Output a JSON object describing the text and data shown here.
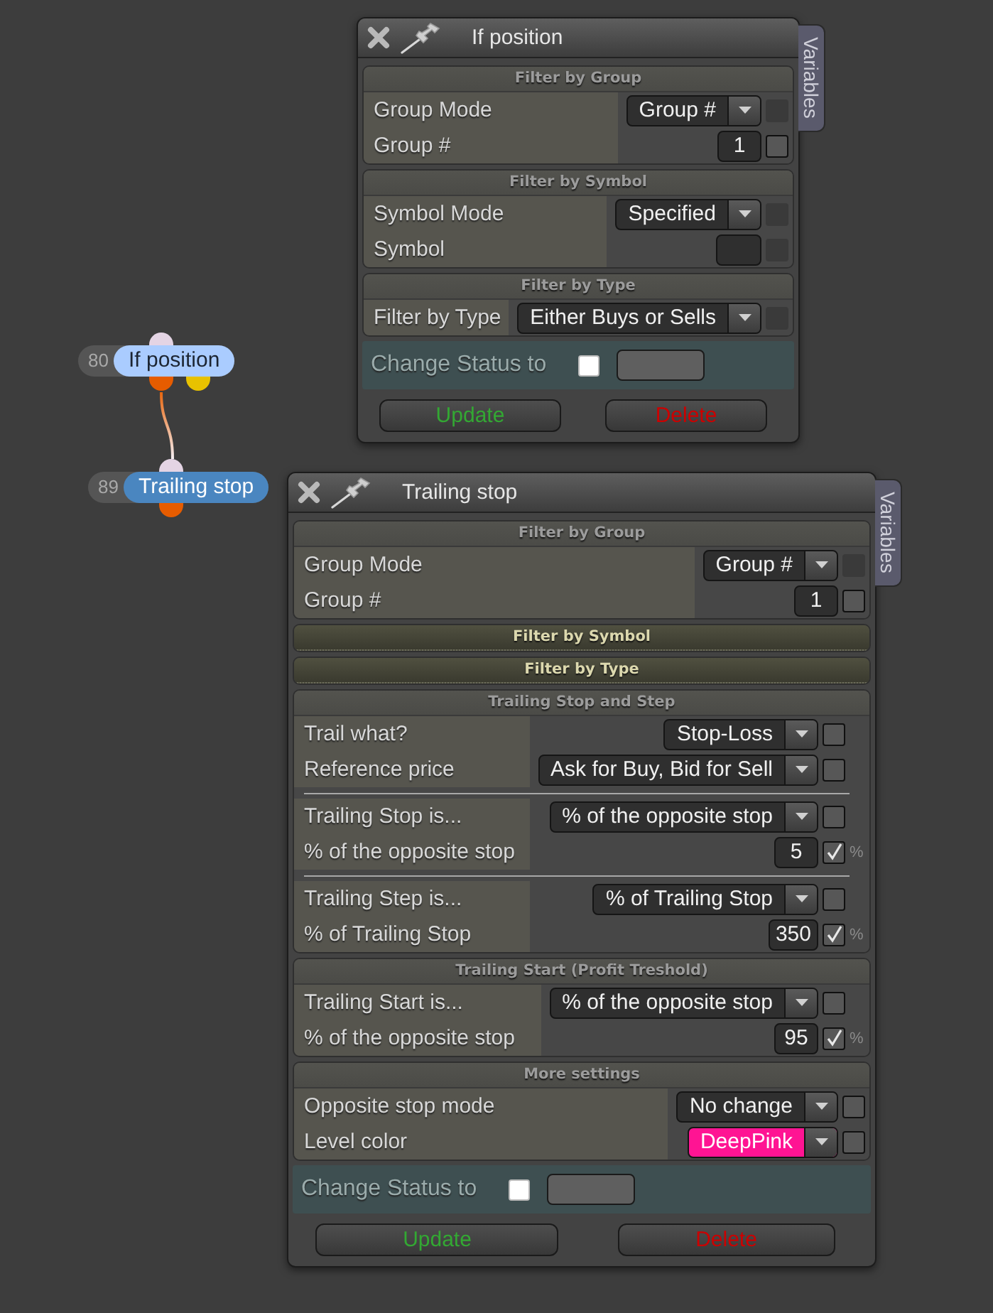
{
  "nodes": [
    {
      "number": "80",
      "title": "If position",
      "color": "#aaccff",
      "ports": [
        {
          "kind": "input",
          "color": "#e4d4e4"
        },
        {
          "kind": "output",
          "color": "#e65c00"
        },
        {
          "kind": "output",
          "color": "#e8c200"
        }
      ]
    },
    {
      "number": "89",
      "title": "Trailing stop",
      "color": "#4a86c0",
      "ports": [
        {
          "kind": "input",
          "color": "#e4d4e4"
        },
        {
          "kind": "output",
          "color": "#e65c00"
        }
      ]
    }
  ],
  "windows": [
    {
      "title": "If position",
      "side_tab": "Variables",
      "sections": [
        {
          "title": "Filter by Group",
          "expanded": true,
          "groups": [
            [
              {
                "kind": "dropdown",
                "label": "Group Mode",
                "value": "Group #",
                "checkbox": {
                  "checked": false,
                  "disabled": true
                }
              },
              {
                "kind": "number",
                "label": "Group #",
                "value": "1",
                "checkbox": {
                  "checked": false,
                  "disabled": false
                }
              }
            ]
          ]
        },
        {
          "title": "Filter by Symbol",
          "expanded": true,
          "groups": [
            [
              {
                "kind": "dropdown",
                "label": "Symbol Mode",
                "value": "Specified",
                "checkbox": {
                  "checked": false,
                  "disabled": true
                }
              },
              {
                "kind": "text",
                "label": "Symbol",
                "checkbox": {
                  "checked": false,
                  "disabled": true
                }
              }
            ]
          ]
        },
        {
          "title": "Filter by Type",
          "expanded": true,
          "groups": [
            [
              {
                "kind": "dropdown",
                "label": "Filter by Type",
                "value": "Either Buys or Sells",
                "checkbox": {
                  "checked": false,
                  "disabled": true
                }
              }
            ]
          ]
        }
      ],
      "status": {
        "label": "Change Status to",
        "checked": false
      },
      "buttons": [
        {
          "kind": "confirm",
          "label": "Update"
        },
        {
          "kind": "danger",
          "label": "Delete"
        }
      ]
    },
    {
      "title": "Trailing stop",
      "side_tab": "Variables",
      "sections": [
        {
          "title": "Filter by Group",
          "expanded": true,
          "groups": [
            [
              {
                "kind": "dropdown",
                "label": "Group Mode",
                "value": "Group #",
                "checkbox": {
                  "checked": false,
                  "disabled": true
                }
              },
              {
                "kind": "number",
                "label": "Group #",
                "value": "1",
                "checkbox": {
                  "checked": false,
                  "disabled": false
                }
              }
            ]
          ]
        },
        {
          "title": "Filter by Symbol",
          "expanded": false
        },
        {
          "title": "Filter by Type",
          "expanded": false
        },
        {
          "title": "Trailing Stop and Step",
          "expanded": true,
          "groups": [
            [
              {
                "kind": "dropdown",
                "label": "Trail what?",
                "value": "Stop-Loss",
                "checkbox": {
                  "checked": false,
                  "disabled": false
                }
              },
              {
                "kind": "dropdown",
                "label": "Reference price",
                "value": "Ask for Buy, Bid for Sell",
                "checkbox": {
                  "checked": false,
                  "disabled": false
                }
              }
            ],
            [
              {
                "kind": "dropdown",
                "label": "Trailing Stop is...",
                "value": "% of the opposite stop",
                "checkbox": {
                  "checked": false,
                  "disabled": false
                }
              },
              {
                "kind": "number",
                "label": "% of the opposite stop",
                "value": "5",
                "checkbox": {
                  "checked": true,
                  "disabled": false
                },
                "unit": "%"
              }
            ],
            [
              {
                "kind": "dropdown",
                "label": "Trailing Step is...",
                "value": "% of Trailing Stop",
                "checkbox": {
                  "checked": false,
                  "disabled": false
                }
              },
              {
                "kind": "number",
                "label": "% of Trailing Stop",
                "value": "350",
                "checkbox": {
                  "checked": true,
                  "disabled": false
                },
                "unit": "%"
              }
            ]
          ]
        },
        {
          "title": "Trailing Start (Profit Treshold)",
          "expanded": true,
          "groups": [
            [
              {
                "kind": "dropdown",
                "label": "Trailing Start is...",
                "value": "% of the opposite stop",
                "checkbox": {
                  "checked": false,
                  "disabled": false
                }
              },
              {
                "kind": "number",
                "label": "% of the opposite stop",
                "value": "95",
                "checkbox": {
                  "checked": true,
                  "disabled": false
                },
                "unit": "%"
              }
            ]
          ]
        },
        {
          "title": "More settings",
          "expanded": true,
          "groups": [
            [
              {
                "kind": "dropdown",
                "label": "Opposite stop mode",
                "value": "No change",
                "checkbox": {
                  "checked": false,
                  "disabled": false
                }
              },
              {
                "kind": "dropdown",
                "label": "Level color",
                "value": "DeepPink",
                "color": "#ff1493",
                "checkbox": {
                  "checked": false,
                  "disabled": false
                }
              }
            ]
          ]
        }
      ],
      "status": {
        "label": "Change Status to",
        "checked": false
      },
      "buttons": [
        {
          "kind": "confirm",
          "label": "Update"
        },
        {
          "kind": "danger",
          "label": "Delete"
        }
      ]
    }
  ]
}
